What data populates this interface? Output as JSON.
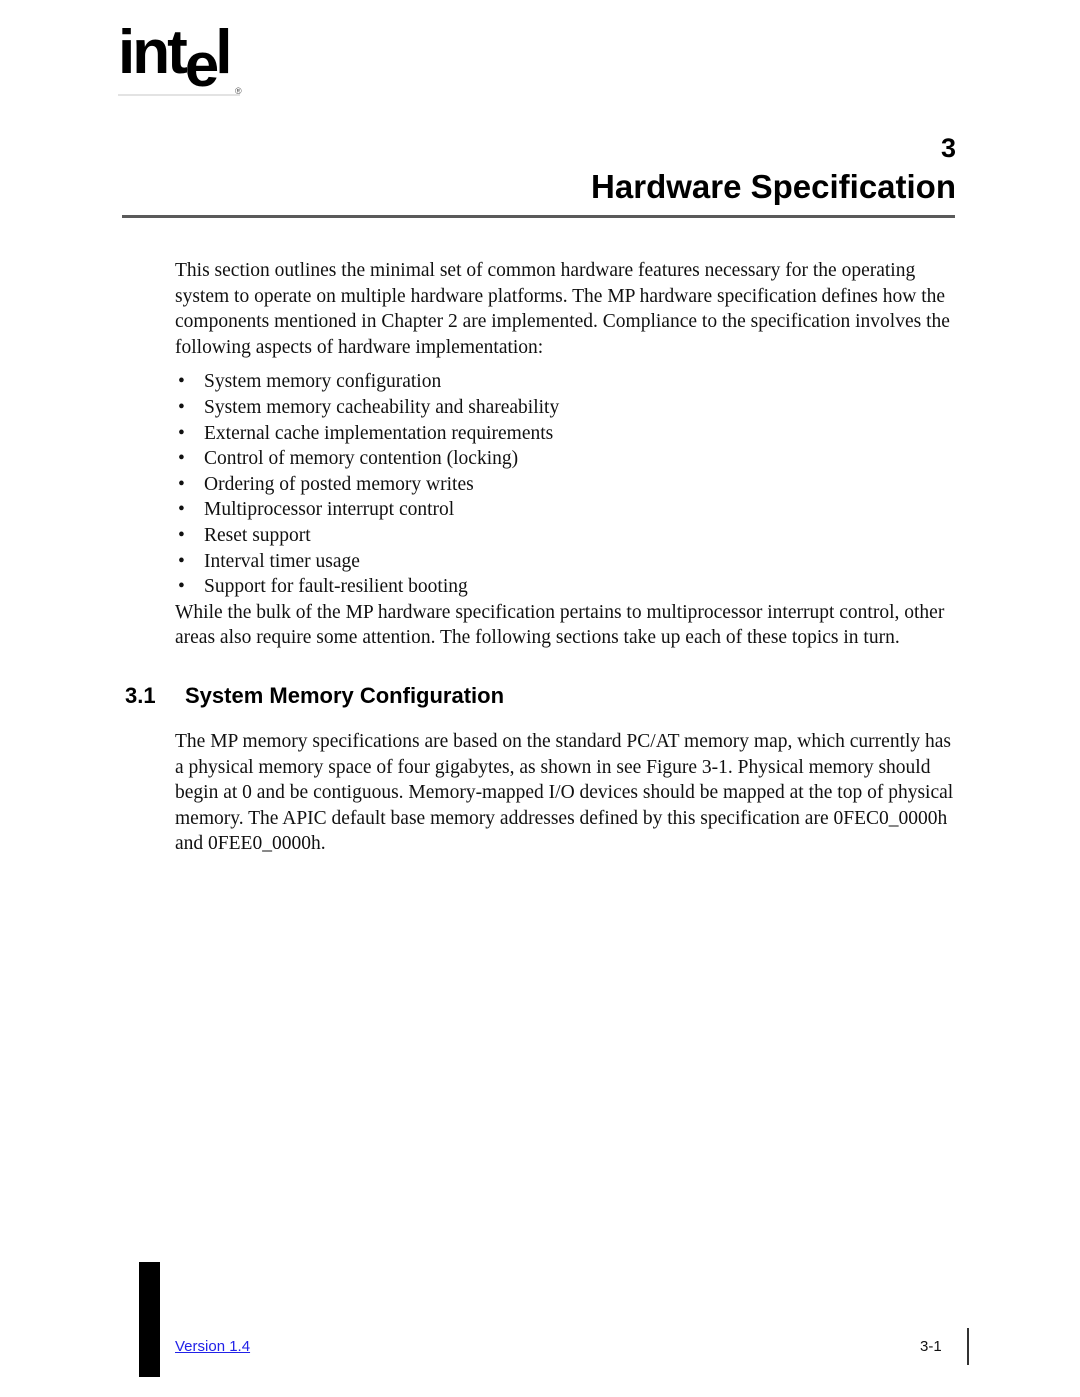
{
  "logo": {
    "text_part1": "int",
    "text_e": "e",
    "text_part2": "l",
    "registered_mark": "®"
  },
  "header": {
    "chapter_number": "3",
    "chapter_title": "Hardware Specification"
  },
  "intro": {
    "paragraph": "This section outlines the minimal set of common hardware features necessary for the operating system to operate on multiple hardware platforms.  The MP hardware specification defines how the components mentioned in Chapter 2 are implemented.  Compliance to the specification involves the following aspects of hardware implementation:",
    "bullet_marker": "•",
    "bullets": [
      "System memory configuration",
      "System memory cacheability and shareability",
      "External cache implementation requirements",
      "Control of memory contention (locking)",
      "Ordering of posted memory writes",
      "Multiprocessor interrupt control",
      "Reset support",
      "Interval timer usage",
      "Support for fault-resilient booting"
    ],
    "closing_paragraph": "While the bulk of the MP hardware specification pertains to multiprocessor interrupt control, other areas also require some attention.  The following sections take up each of these topics in turn."
  },
  "section": {
    "number": "3.1",
    "title": "System Memory Configuration",
    "paragraph": "The MP memory specifications are based on the standard PC/AT memory map, which currently has a physical memory space of four gigabytes, as shown in see Figure 3-1.  Physical memory should begin at 0 and be contiguous.  Memory-mapped I/O devices should be mapped at the top of physical memory.  The APIC default base memory addresses defined by this specification are 0FEC0_0000h and 0FEE0_0000h."
  },
  "footer": {
    "version": "Version 1.4",
    "page_number": "3-1",
    "link_color": "#2222e8"
  }
}
